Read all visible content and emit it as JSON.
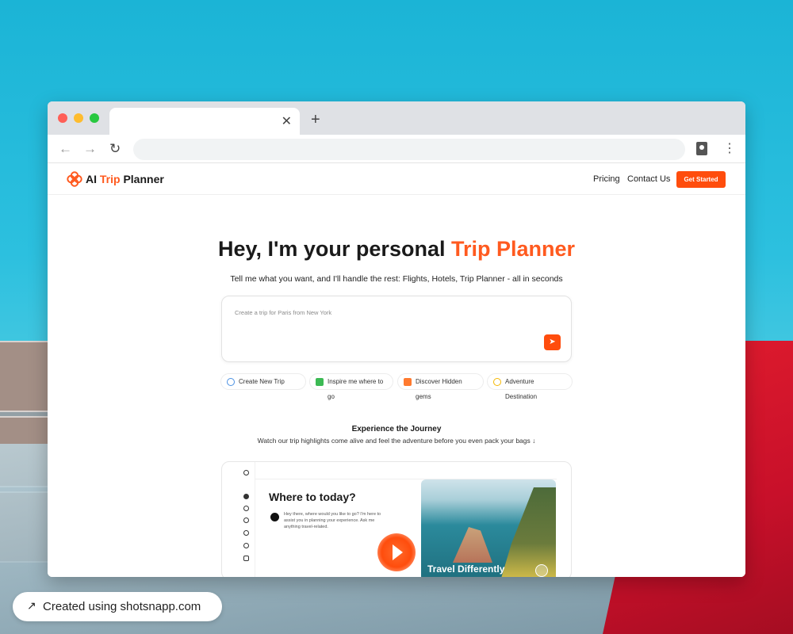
{
  "site": {
    "logo_brand_prefix": "AI",
    "logo_brand_accent": "Trip",
    "logo_brand_suffix": "Planner",
    "nav": {
      "pricing": "Pricing",
      "contact": "Contact Us",
      "cta": "Get Started"
    }
  },
  "hero": {
    "title_prefix": "Hey, I'm your personal",
    "title_accent": "Trip Planner",
    "subtitle": "Tell me what you want, and I'll handle the rest: Flights, Hotels, Trip Planner - all in seconds"
  },
  "prompt": {
    "placeholder": "Create a trip for Paris from New York"
  },
  "chips": [
    {
      "label": "Create New Trip",
      "icon": "globe-icon"
    },
    {
      "label": "Inspire me where to go",
      "icon": "plane-icon"
    },
    {
      "label": "Discover Hidden gems",
      "icon": "landmark-icon"
    },
    {
      "label": "Adventure Destination",
      "icon": "compass-icon"
    }
  ],
  "journey": {
    "title": "Experience the Journey",
    "subtitle": "Watch our trip highlights come alive and feel the adventure before you even pack your bags"
  },
  "preview": {
    "title": "Where to today?",
    "text": "Hey there, where would you like to go? I'm here to assist you in planning your experience. Ask me anything travel-related.",
    "caption": "Travel Differently"
  },
  "badge": {
    "text": "Created using shotsnapp.com"
  },
  "colors": {
    "accent": "#ff5a1f",
    "cta": "#ff4d0d",
    "background_top": "#1bb4d6"
  }
}
